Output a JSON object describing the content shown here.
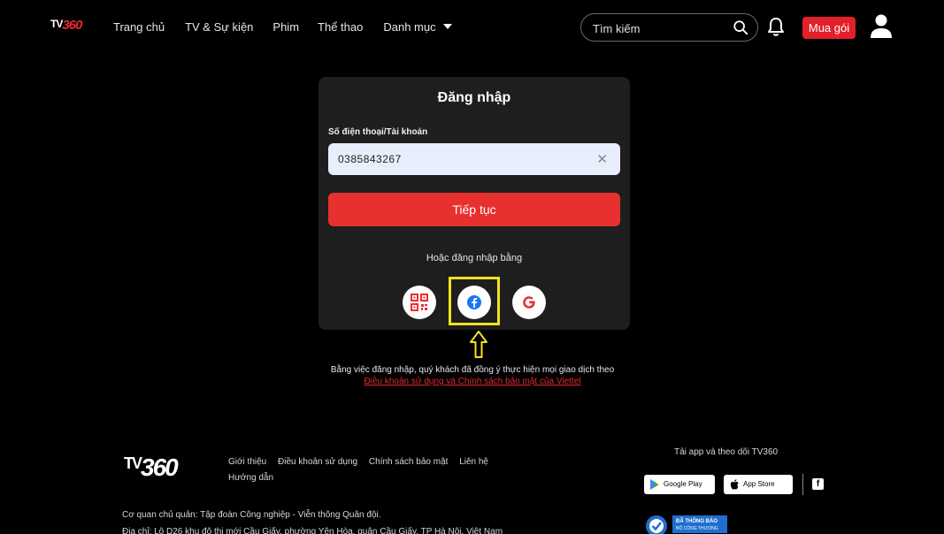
{
  "header": {
    "logo_tv": "TV",
    "logo_num": "360",
    "nav": [
      "Trang chủ",
      "TV & Sự kiện",
      "Phim",
      "Thể thao",
      "Danh mục"
    ],
    "search_placeholder": "Tìm kiếm",
    "buy_label": "Mua gói"
  },
  "login": {
    "title": "Đăng nhập",
    "field_label": "Số điện thoại/Tài khoản",
    "field_value": "0385843267",
    "clear_glyph": "✕",
    "continue_label": "Tiếp tục",
    "or_label": "Hoặc đăng nhập bằng",
    "social": [
      "qr-code-icon",
      "facebook-icon",
      "google-icon"
    ]
  },
  "terms": {
    "text": "Bằng việc đăng nhập, quý khách đã đồng ý thực hiện mọi giao dịch theo ",
    "link": "Điều khoản sử dụng và Chính sách bảo mật của Viettel"
  },
  "footer": {
    "logo_tv": "TV",
    "logo_num": "360",
    "links_row1": [
      "Giới thiệu",
      "Điều khoản sử dụng",
      "Chính sách bảo mật",
      "Liên hệ"
    ],
    "links_row2": [
      "Hướng dẫn"
    ],
    "app_label": "Tải app và theo dõi TV360",
    "google_play": "Google Play",
    "app_store": "App Store",
    "facebook_glyph": "f",
    "address1": "Cơ quan chủ quản: Tập đoàn Công nghiệp - Viễn thông Quân đội.",
    "address2": "Địa chỉ: Lô D26 khu đô thị mới Cầu Giấy, phường Yên Hòa, quận Cầu Giấy, TP Hà Nội, Việt Nam",
    "badge_line1": "ĐÃ THÔNG BÁO",
    "badge_line2": "BỘ CÔNG THƯƠNG"
  },
  "colors": {
    "accent": "#e8302f",
    "highlight": "#f2e21f",
    "card_bg": "#1e1e1e"
  }
}
